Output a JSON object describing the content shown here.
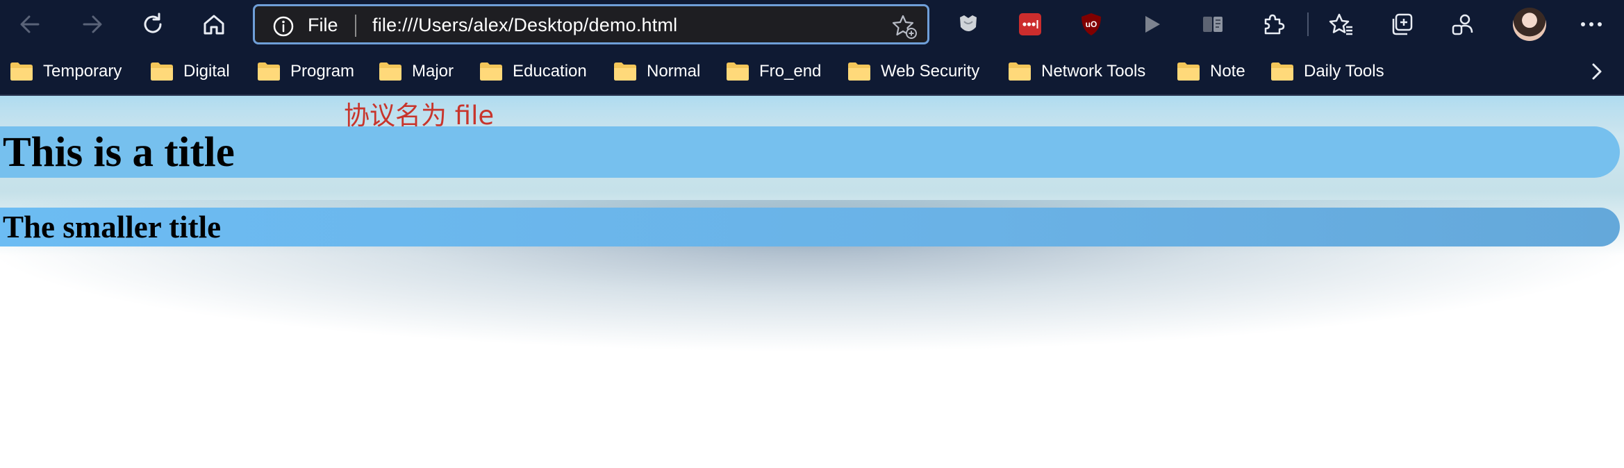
{
  "colors": {
    "toolbar_bg": "#0f1a33",
    "address_border": "#6f9fd8",
    "h1_band": "#76c0ee",
    "h2_band": "#6ab2e6",
    "annotation": "#c8352c"
  },
  "toolbar": {
    "back_icon": "arrow-left-icon",
    "forward_icon": "arrow-right-icon",
    "refresh_icon": "refresh-icon",
    "home_icon": "home-icon",
    "address": {
      "scheme_label": "File",
      "url": "file:///Users/alex/Desktop/demo.html"
    },
    "extensions": [
      "shield-extension-icon",
      "lastpass-icon",
      "ublock-icon",
      "play-icon",
      "reader-icon",
      "puzzle-icon",
      "favorites-icon",
      "collections-icon",
      "profile-switch-icon",
      "avatar",
      "more-icon"
    ]
  },
  "bookmarks": [
    {
      "label": "Temporary"
    },
    {
      "label": "Digital"
    },
    {
      "label": "Program"
    },
    {
      "label": "Major"
    },
    {
      "label": "Education"
    },
    {
      "label": "Normal"
    },
    {
      "label": "Fro_end"
    },
    {
      "label": "Web Security"
    },
    {
      "label": "Network Tools"
    },
    {
      "label": "Note"
    },
    {
      "label": "Daily Tools"
    }
  ],
  "page": {
    "h1": "This is a title",
    "h2": "The smaller title",
    "annotation": "协议名为 file"
  }
}
